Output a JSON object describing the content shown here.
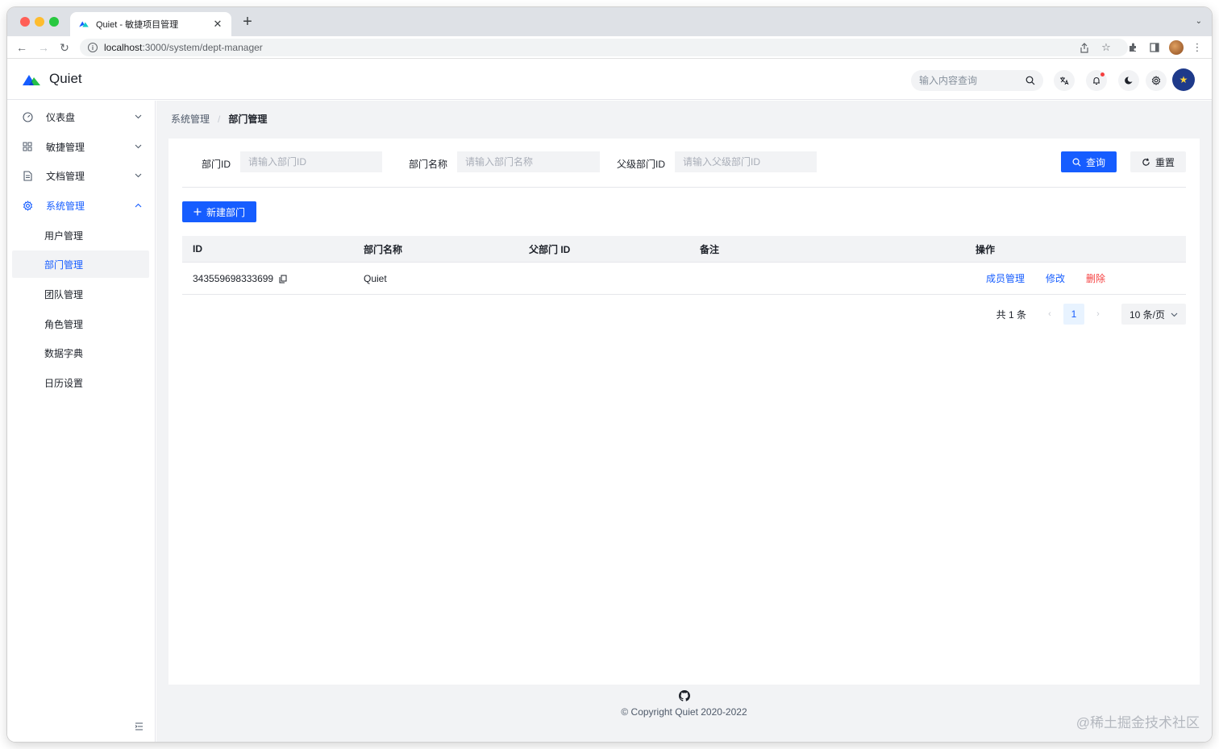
{
  "browser": {
    "tab_title": "Quiet - 敏捷项目管理",
    "url_host": "localhost",
    "url_rest": ":3000/system/dept-manager"
  },
  "header": {
    "app_name": "Quiet",
    "search_placeholder": "输入内容查询",
    "icons": [
      "translate-icon",
      "bell-icon",
      "moon-icon",
      "gear-icon"
    ]
  },
  "sidebar": {
    "items": [
      {
        "label": "仪表盘",
        "icon": "dashboard-icon"
      },
      {
        "label": "敏捷管理",
        "icon": "grid-icon"
      },
      {
        "label": "文档管理",
        "icon": "document-icon"
      },
      {
        "label": "系统管理",
        "icon": "gear-icon"
      }
    ],
    "sub_items": [
      {
        "label": "用户管理"
      },
      {
        "label": "部门管理"
      },
      {
        "label": "团队管理"
      },
      {
        "label": "角色管理"
      },
      {
        "label": "数据字典"
      },
      {
        "label": "日历设置"
      }
    ]
  },
  "breadcrumb": {
    "parent": "系统管理",
    "separator": "/",
    "current": "部门管理"
  },
  "form": {
    "dept_id_label": "部门ID",
    "dept_id_placeholder": "请输入部门ID",
    "dept_name_label": "部门名称",
    "dept_name_placeholder": "请输入部门名称",
    "parent_id_label": "父级部门ID",
    "parent_id_placeholder": "请输入父级部门ID",
    "search_button": "查询",
    "reset_button": "重置"
  },
  "toolbar": {
    "new_button": "新建部门"
  },
  "table": {
    "headers": [
      "ID",
      "部门名称",
      "父部门 ID",
      "备注",
      "操作"
    ],
    "rows": [
      {
        "id": "343559698333699",
        "name": "Quiet",
        "parent_id": "",
        "remark": ""
      }
    ],
    "actions": [
      "成员管理",
      "修改",
      "删除"
    ]
  },
  "pagination": {
    "total_text": "共 1 条",
    "current_page": "1",
    "page_size": "10 条/页"
  },
  "footer": {
    "copyright": "© Copyright Quiet 2020-2022"
  },
  "watermark": "@稀土掘金技术社区",
  "colors": {
    "primary": "#165dff",
    "danger": "#f53f3f",
    "background": "#f2f3f5"
  }
}
